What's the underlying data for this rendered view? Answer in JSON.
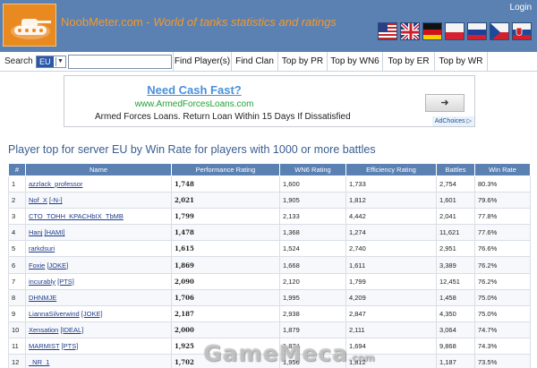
{
  "header": {
    "site_name": "NoobMeter.com",
    "separator": " - ",
    "tagline": "World of tanks statistics and ratings",
    "login_label": "Login",
    "flags": [
      {
        "icon": "flag-usa-icon"
      },
      {
        "icon": "flag-uk-icon"
      },
      {
        "icon": "flag-germany-icon"
      },
      {
        "icon": "flag-poland-icon"
      },
      {
        "icon": "flag-russia-icon"
      },
      {
        "icon": "flag-czech-icon"
      },
      {
        "icon": "flag-slovakia-icon"
      }
    ]
  },
  "search": {
    "label": "Search",
    "region_value": "EU",
    "input_value": ""
  },
  "nav": {
    "find_player": "Find Player(s)",
    "find_clan": "Find Clan",
    "top_pr": "Top by PR",
    "top_wn6": "Top by WN6",
    "top_er": "Top by ER",
    "top_wr": "Top by WR"
  },
  "ad": {
    "title": "Need Cash Fast?",
    "url": "www.ArmedForcesLoans.com",
    "text": "Armed Forces Loans. Return Loan Within 15 Days If Dissatisfied",
    "arrow": "➜",
    "adchoices": "AdChoices ▷"
  },
  "heading": "Player top for server EU by Win Rate for players with 1000 or more battles",
  "table": {
    "columns": [
      "#",
      "Name",
      "Performance Rating",
      "WN6 Rating",
      "Efficiency Rating",
      "Battles",
      "Win Rate"
    ],
    "rows": [
      {
        "n": "1",
        "player": "azzlack_professor",
        "clan": "",
        "pr": "1,748",
        "wn6": "1,600",
        "er": "1,733",
        "battles": "2,754",
        "wr": "80.3%"
      },
      {
        "n": "2",
        "player": "Nof_X",
        "clan": "[-N-]",
        "pr": "2,021",
        "wn6": "1,905",
        "er": "1,812",
        "battles": "1,601",
        "wr": "79.6%"
      },
      {
        "n": "3",
        "player": "CTO_TOHH_KPACHbIX_TbMB",
        "clan": "",
        "pr": "1,799",
        "wn6": "2,133",
        "er": "4,442",
        "battles": "2,041",
        "wr": "77.8%"
      },
      {
        "n": "4",
        "player": "Hanj",
        "clan": "[HAMI]",
        "pr": "1,478",
        "wn6": "1,368",
        "er": "1,274",
        "battles": "11,621",
        "wr": "77.6%"
      },
      {
        "n": "5",
        "player": "rarkdsuri",
        "clan": "",
        "pr": "1,615",
        "wn6": "1,524",
        "er": "2,740",
        "battles": "2,951",
        "wr": "76.6%"
      },
      {
        "n": "6",
        "player": "Foxie",
        "clan": "[JOKE]",
        "pr": "1,869",
        "wn6": "1,668",
        "er": "1,611",
        "battles": "3,389",
        "wr": "76.2%"
      },
      {
        "n": "7",
        "player": "incurably",
        "clan": "[PTS]",
        "pr": "2,090",
        "wn6": "2,120",
        "er": "1,799",
        "battles": "12,451",
        "wr": "76.2%"
      },
      {
        "n": "8",
        "player": "DHNMJE",
        "clan": "",
        "pr": "1,706",
        "wn6": "1,995",
        "er": "4,209",
        "battles": "1,458",
        "wr": "75.0%"
      },
      {
        "n": "9",
        "player": "LiannaSilverwind",
        "clan": "[JOKE]",
        "pr": "2,187",
        "wn6": "2,938",
        "er": "2,847",
        "battles": "4,350",
        "wr": "75.0%"
      },
      {
        "n": "10",
        "player": "Xensation",
        "clan": "[IDEAL]",
        "pr": "2,000",
        "wn6": "1,879",
        "er": "2,111",
        "battles": "3,064",
        "wr": "74.7%"
      },
      {
        "n": "11",
        "player": "MARMIST",
        "clan": "[PTS]",
        "pr": "1,925",
        "wn6": "1,874",
        "er": "1,694",
        "battles": "9,868",
        "wr": "74.3%"
      },
      {
        "n": "12",
        "player": "_NR_1",
        "clan": "",
        "pr": "1,702",
        "wn6": "1,956",
        "er": "1,812",
        "battles": "1,187",
        "wr": "73.5%"
      }
    ]
  },
  "watermark": {
    "text": "GameMeca",
    "domain": ".com"
  }
}
